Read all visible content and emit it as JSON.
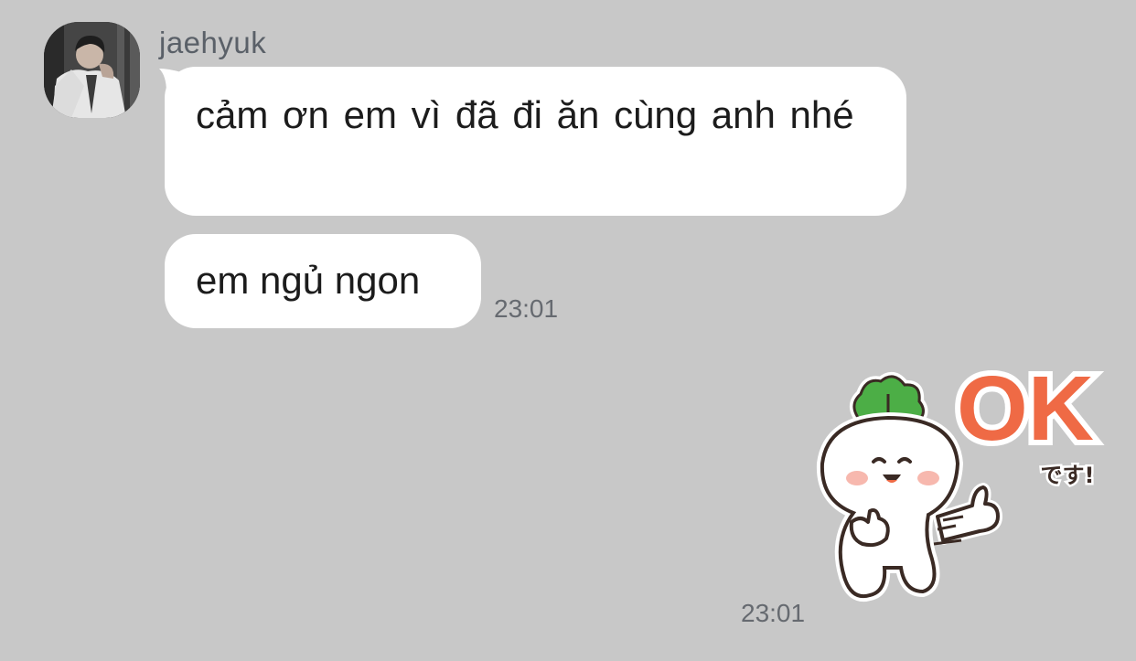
{
  "chat": {
    "sender": {
      "name": "jaehyuk",
      "avatar_icon": "profile-photo"
    },
    "messages": [
      {
        "text": "cảm ơn em vì đã đi ăn cùng anh nhé"
      },
      {
        "text": "em ngủ ngon",
        "time": "23:01"
      }
    ],
    "sticker": {
      "icon": "radish-thumbs-up-sticker",
      "ok_text": "OK",
      "sub_text": "です!",
      "time": "23:01"
    }
  },
  "colors": {
    "background": "#c8c8c8",
    "bubble": "#ffffff",
    "ok_orange": "#ef6a45",
    "leaf_green": "#4cae46"
  }
}
